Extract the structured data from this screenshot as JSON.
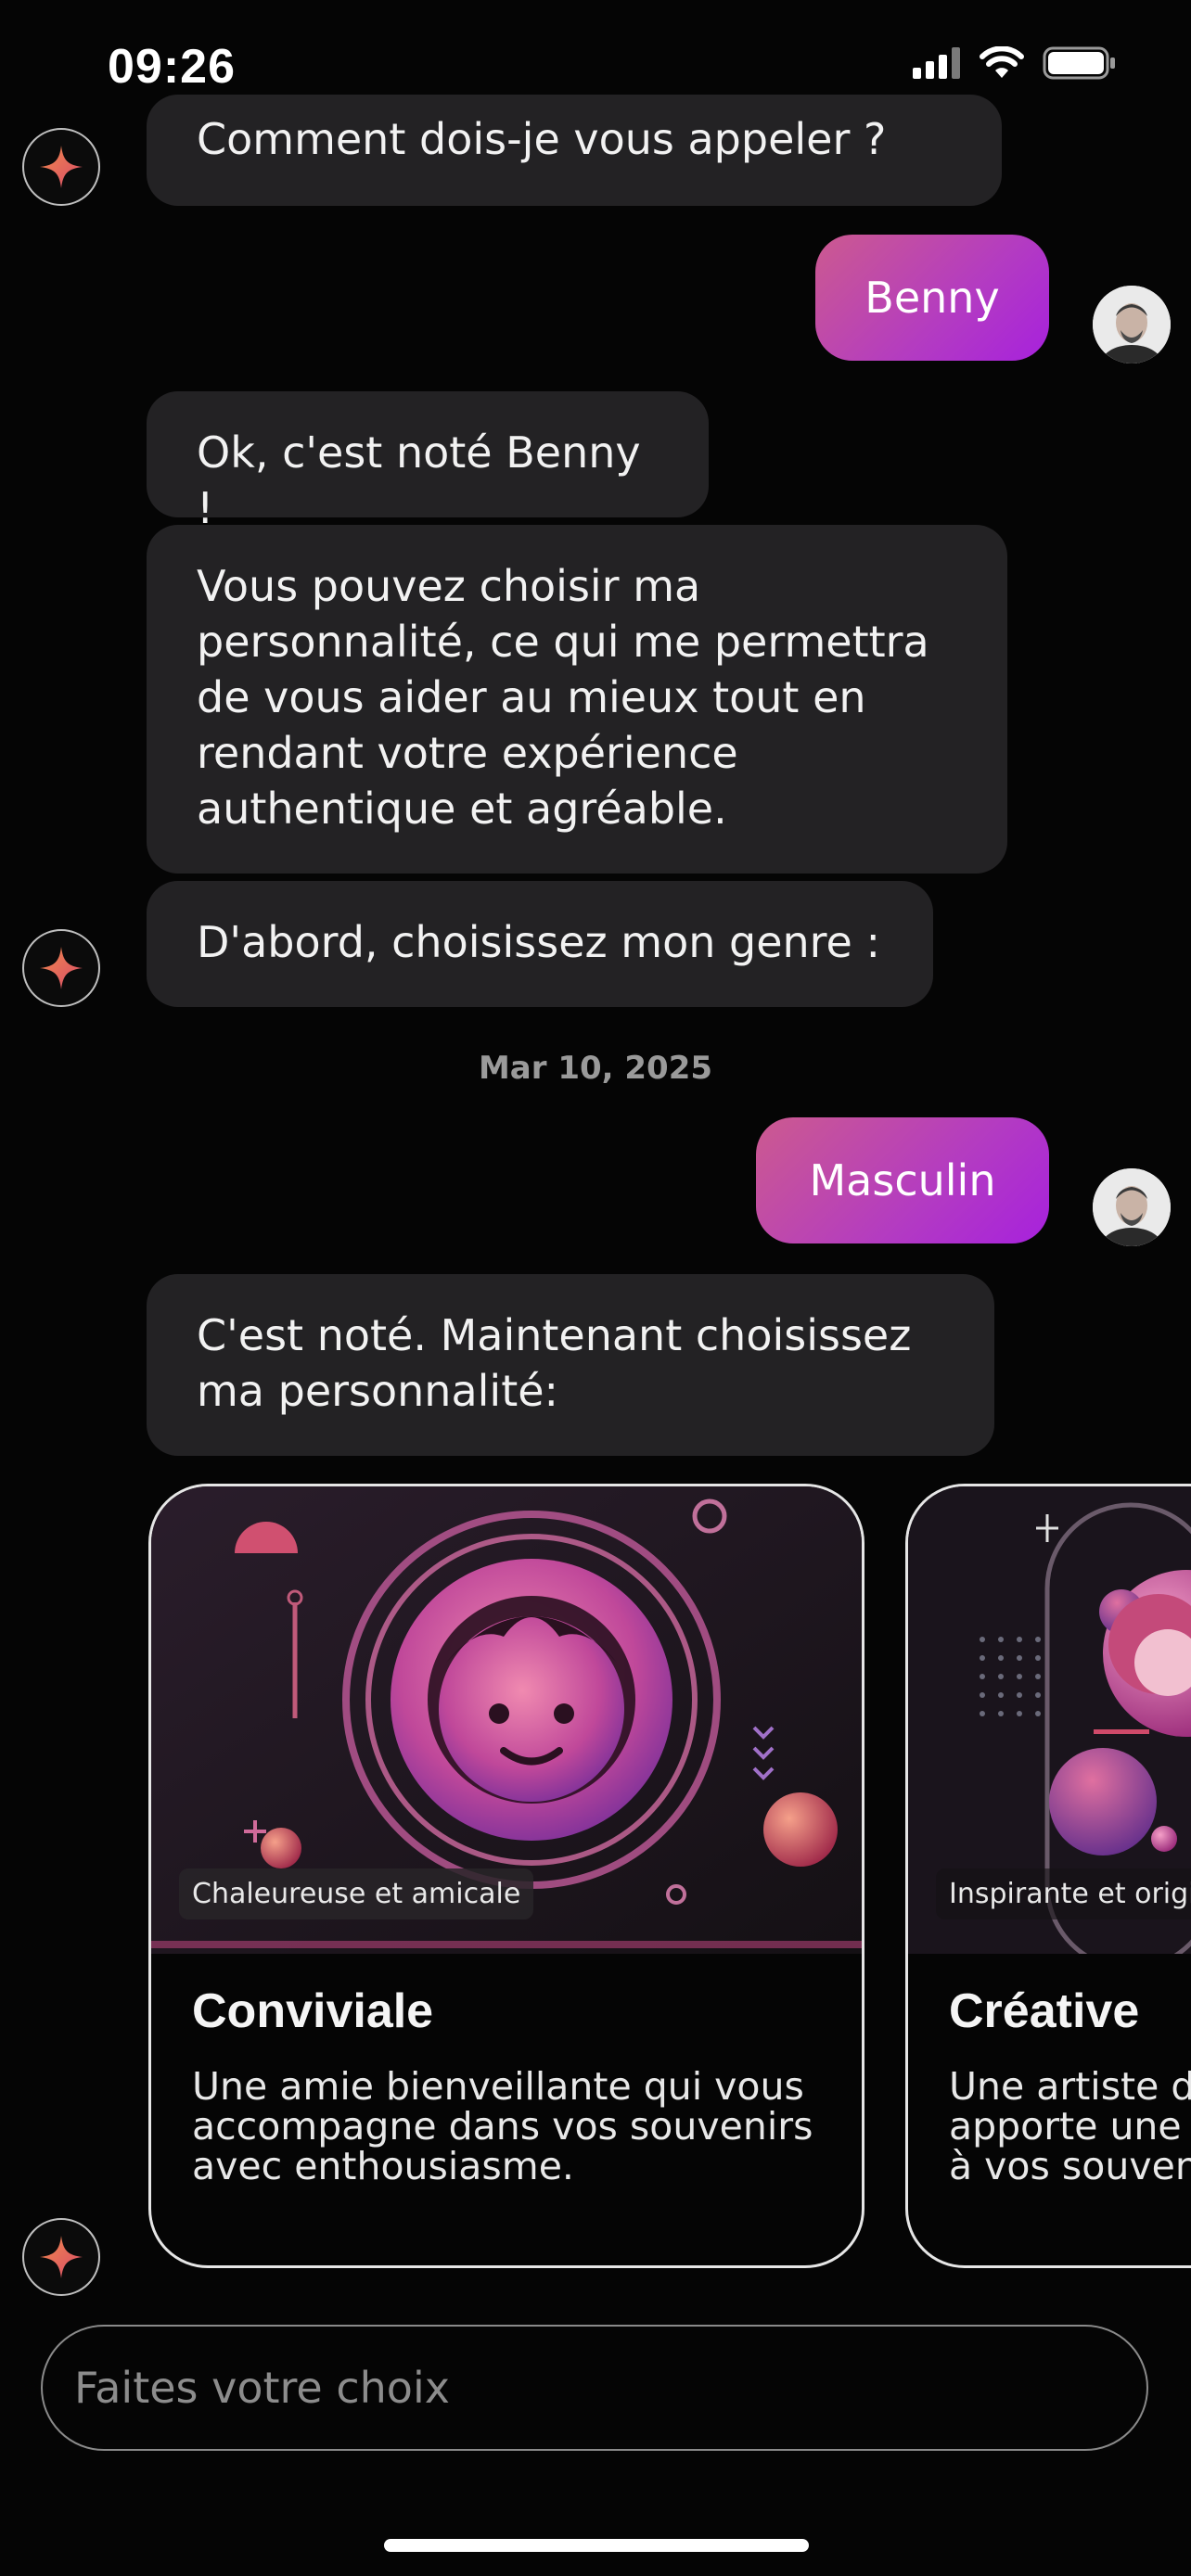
{
  "status_bar": {
    "time": "09:26"
  },
  "chat": {
    "bot_messages": [
      "Comment dois-je vous appeler ?",
      "Ok, c'est noté Benny !",
      "Vous pouvez choisir ma personnalité, ce qui me permettra de vous aider au mieux tout en rendant votre expérience authentique et agréable.",
      "D'abord, choisissez mon genre :",
      "C'est noté. Maintenant choisissez ma personnalité:"
    ],
    "user_messages": [
      "Benny",
      "Masculin"
    ],
    "date_separator": "Mar 10, 2025"
  },
  "cards": [
    {
      "tag": "Chaleureuse et amicale",
      "title": "Conviviale",
      "description": "Une amie bienveillante qui vous accompagne dans vos souvenirs avec enthousiasme."
    },
    {
      "tag": "Inspirante et origi",
      "title": "Créative",
      "description": "Une artiste d apporte une à vos souven"
    }
  ],
  "input": {
    "placeholder": "Faites votre choix"
  },
  "colors": {
    "background": "#050505",
    "bot_bubble": "#232224",
    "user_bubble_start": "#cc5a8f",
    "user_bubble_end": "#a721dd",
    "accent_star": "#e8604c"
  },
  "icons": {
    "bot_avatar": "sparkle-star-icon",
    "user_avatar": "user-photo-avatar",
    "signal": "cellular-signal-icon",
    "wifi": "wifi-icon",
    "battery": "battery-icon"
  }
}
